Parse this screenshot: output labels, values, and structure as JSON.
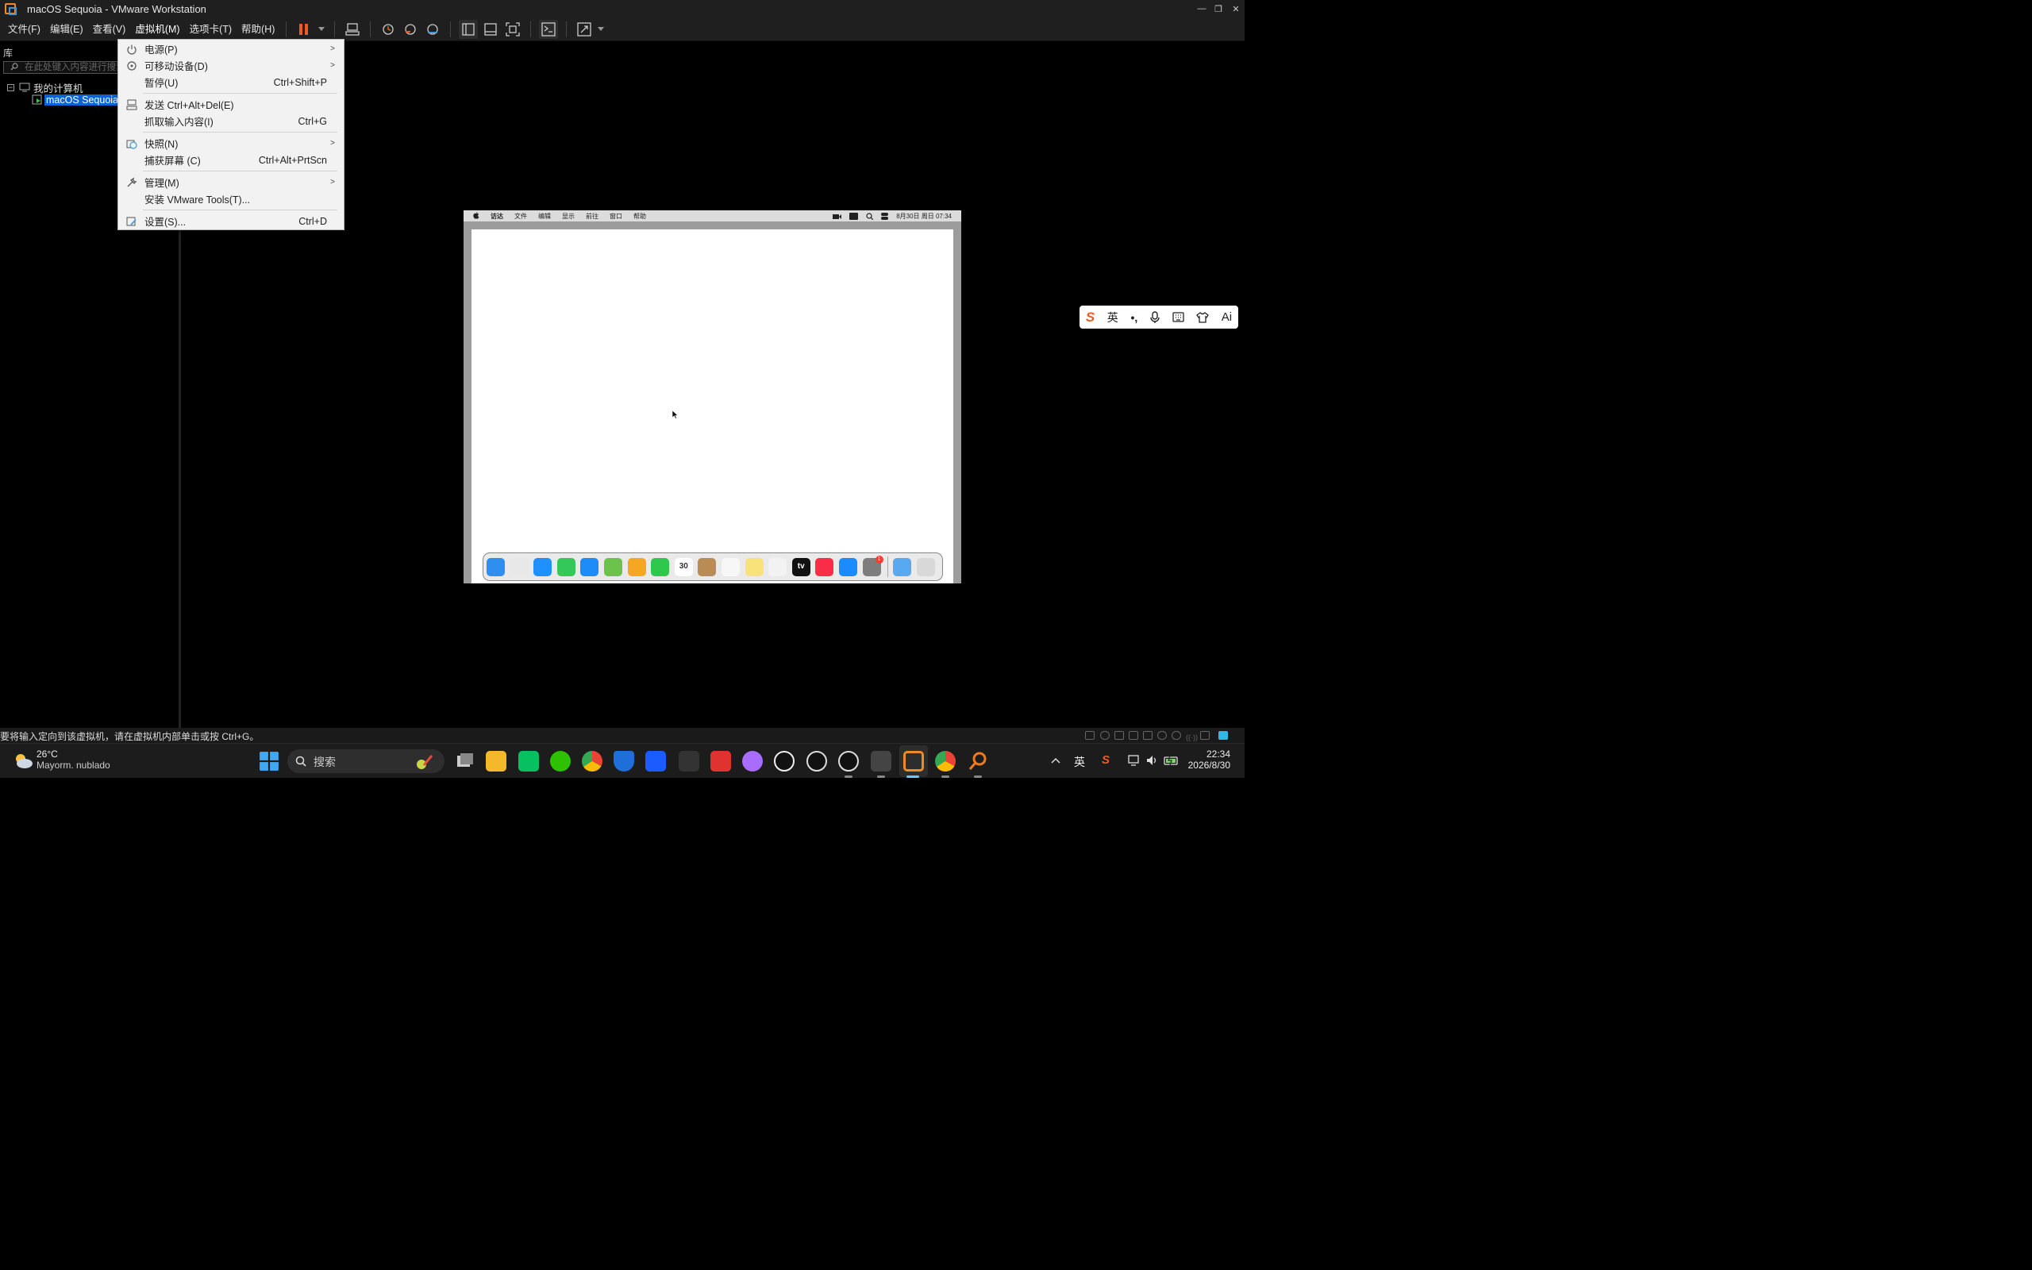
{
  "window": {
    "title": "macOS Sequoia - VMware Workstation",
    "controls": [
      "minimize",
      "restore",
      "close"
    ]
  },
  "menubar": {
    "items": [
      {
        "label": "文件(F)"
      },
      {
        "label": "编辑(E)"
      },
      {
        "label": "查看(V)"
      },
      {
        "label": "虚拟机(M)",
        "active": true
      },
      {
        "label": "选项卡(T)"
      },
      {
        "label": "帮助(H)"
      }
    ]
  },
  "toolbar": {
    "icons": [
      "pause-icon",
      "dropdown-arrow-icon",
      "send-ctrl-alt-del-icon",
      "snapshot-take-icon",
      "snapshot-revert-icon",
      "snapshot-manager-icon",
      "show-library-icon",
      "show-thumbnail-icon",
      "fullscreen-icon",
      "console-view-icon",
      "stretch-icon"
    ],
    "accent": "#f05a22"
  },
  "library": {
    "title": "库",
    "search_placeholder": "在此处键入内容进行搜索",
    "tree": {
      "root": {
        "label": "我的计算机",
        "expander": "−"
      },
      "children": [
        {
          "label": "macOS Sequoia",
          "selected": true
        }
      ]
    }
  },
  "vm_menu": {
    "items": [
      {
        "label": "电源(P)",
        "shortcut": "",
        "submenu": true,
        "icon": "power-icon"
      },
      {
        "label": "可移动设备(D)",
        "shortcut": "",
        "submenu": true,
        "icon": "removable-device-icon"
      },
      {
        "label": "暂停(U)",
        "shortcut": "Ctrl+Shift+P",
        "submenu": false,
        "icon": ""
      },
      {
        "label": "发送 Ctrl+Alt+Del(E)",
        "shortcut": "",
        "submenu": false,
        "icon": "send-keys-icon"
      },
      {
        "label": "抓取输入内容(I)",
        "shortcut": "Ctrl+G",
        "submenu": false,
        "icon": ""
      },
      {
        "label": "快照(N)",
        "shortcut": "",
        "submenu": true,
        "icon": "snapshot-icon"
      },
      {
        "label": "捕获屏幕 (C)",
        "shortcut": "Ctrl+Alt+PrtScn",
        "submenu": false,
        "icon": ""
      },
      {
        "label": "管理(M)",
        "shortcut": "",
        "submenu": true,
        "icon": "wrench-icon"
      },
      {
        "label": "安装 VMware Tools(T)...",
        "shortcut": "",
        "submenu": false,
        "icon": ""
      },
      {
        "label": "设置(S)...",
        "shortcut": "Ctrl+D",
        "submenu": false,
        "icon": "settings-icon"
      }
    ]
  },
  "guest": {
    "menubar": {
      "apple": "",
      "items": [
        "访达",
        "文件",
        "编辑",
        "显示",
        "前往",
        "窗口",
        "帮助"
      ],
      "datetime": "8月30日 周日  07:34"
    },
    "dock": {
      "apps": [
        {
          "name": "finder-icon",
          "color": "#2f8ff0"
        },
        {
          "name": "launchpad-icon",
          "color": "#e8e8e8"
        },
        {
          "name": "safari-icon",
          "color": "#1e90ff"
        },
        {
          "name": "messages-icon",
          "color": "#34c759"
        },
        {
          "name": "mail-icon",
          "color": "#1d8cf8"
        },
        {
          "name": "maps-icon",
          "color": "#6cc24a"
        },
        {
          "name": "photos-icon",
          "color": "#f5a623"
        },
        {
          "name": "facetime-icon",
          "color": "#2ec94c"
        },
        {
          "name": "calendar-icon",
          "color": "#ffffff",
          "text": "30"
        },
        {
          "name": "contacts-icon",
          "color": "#b98b55"
        },
        {
          "name": "reminders-icon",
          "color": "#f7f7f7"
        },
        {
          "name": "notes-icon",
          "color": "#f9e27a"
        },
        {
          "name": "freeform-icon",
          "color": "#f2f2f2"
        },
        {
          "name": "apple-tv-icon",
          "color": "#111111",
          "text": "tv"
        },
        {
          "name": "music-icon",
          "color": "#fa2d48"
        },
        {
          "name": "app-store-icon",
          "color": "#1a8cff"
        },
        {
          "name": "system-settings-icon",
          "color": "#7d7d7d",
          "badge": "1"
        }
      ],
      "extras": [
        {
          "name": "downloads-folder-icon",
          "color": "#58a9ef"
        },
        {
          "name": "trash-icon",
          "color": "#d8d8d8"
        }
      ]
    }
  },
  "ime": {
    "lang": "英",
    "icons": [
      "sogou-logo-icon",
      "punctuation-icon",
      "microphone-icon",
      "keyboard-icon",
      "skin-icon",
      "ai-icon"
    ],
    "ai_label": "Ai"
  },
  "statusbar": {
    "message": "要将输入定向到该虚拟机，请在虚拟机内部单击或按 Ctrl+G。"
  },
  "taskbar": {
    "weather": {
      "temp": "26°C",
      "desc": "Mayorm. nublado"
    },
    "search_placeholder": "搜索",
    "apps": [
      "start-icon",
      "search-icon",
      "task-view-icon",
      "file-explorer-icon",
      "wechat-work-icon",
      "wechat-icon",
      "chrome-icon",
      "shield-app-icon",
      "feishu-icon",
      "unity-icon",
      "wps-icon",
      "cat-app-icon",
      "qq-icon",
      "chatgpt-icon",
      "chatgpt-alt-icon",
      "box-app-icon",
      "vmware-icon",
      "chrome-profile-icon",
      "search-tool-icon"
    ],
    "tray": {
      "lang": "英",
      "time": "22:34",
      "date": "2026/8/30"
    }
  }
}
